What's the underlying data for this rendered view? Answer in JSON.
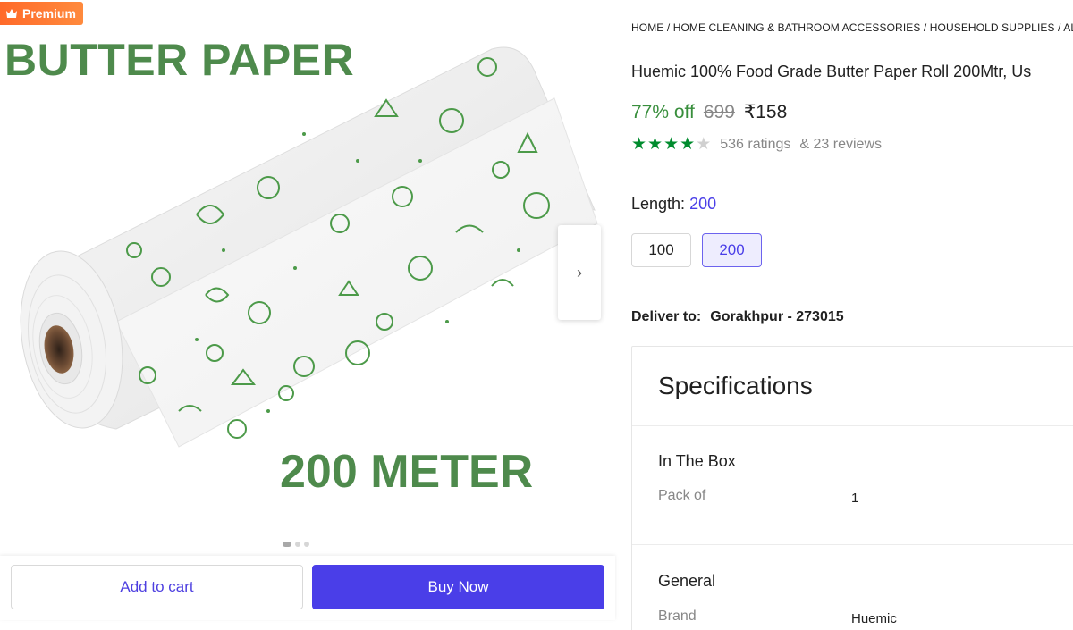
{
  "badge": {
    "label": "Premium",
    "icon": "crown-icon"
  },
  "image": {
    "headline": "BUTTER PAPER",
    "subline": "200 METER",
    "carousel": {
      "count": 3,
      "active_index": 0
    }
  },
  "actions": {
    "add_to_cart": "Add to cart",
    "buy_now": "Buy Now"
  },
  "breadcrumb": "HOME / HOME CLEANING & BATHROOM ACCESSORIES / HOUSEHOLD SUPPLIES / ALU",
  "product": {
    "title": "Huemic 100% Food Grade Butter Paper Roll 200Mtr, Us",
    "discount": "77% off",
    "mrp": "699",
    "price": "₹158",
    "rating_stars": 4,
    "ratings": "536 ratings",
    "reviews": "& 23 reviews"
  },
  "length": {
    "label": "Length:",
    "selected": "200",
    "options": [
      "100",
      "200"
    ]
  },
  "delivery": {
    "label": "Deliver to:",
    "location": "Gorakhpur - 273015"
  },
  "specifications": {
    "title": "Specifications",
    "groups": [
      {
        "title": "In The Box",
        "rows": [
          {
            "key": "Pack of",
            "value": "1"
          }
        ]
      },
      {
        "title": "General",
        "rows": [
          {
            "key": "Brand",
            "value": "Huemic"
          }
        ]
      }
    ]
  },
  "colors": {
    "accent": "#4a3ee8",
    "discount_green": "#388e3c",
    "star_green": "#008c2e",
    "image_text_green": "#4e8a4c",
    "premium_orange": "#ff6a2a"
  }
}
